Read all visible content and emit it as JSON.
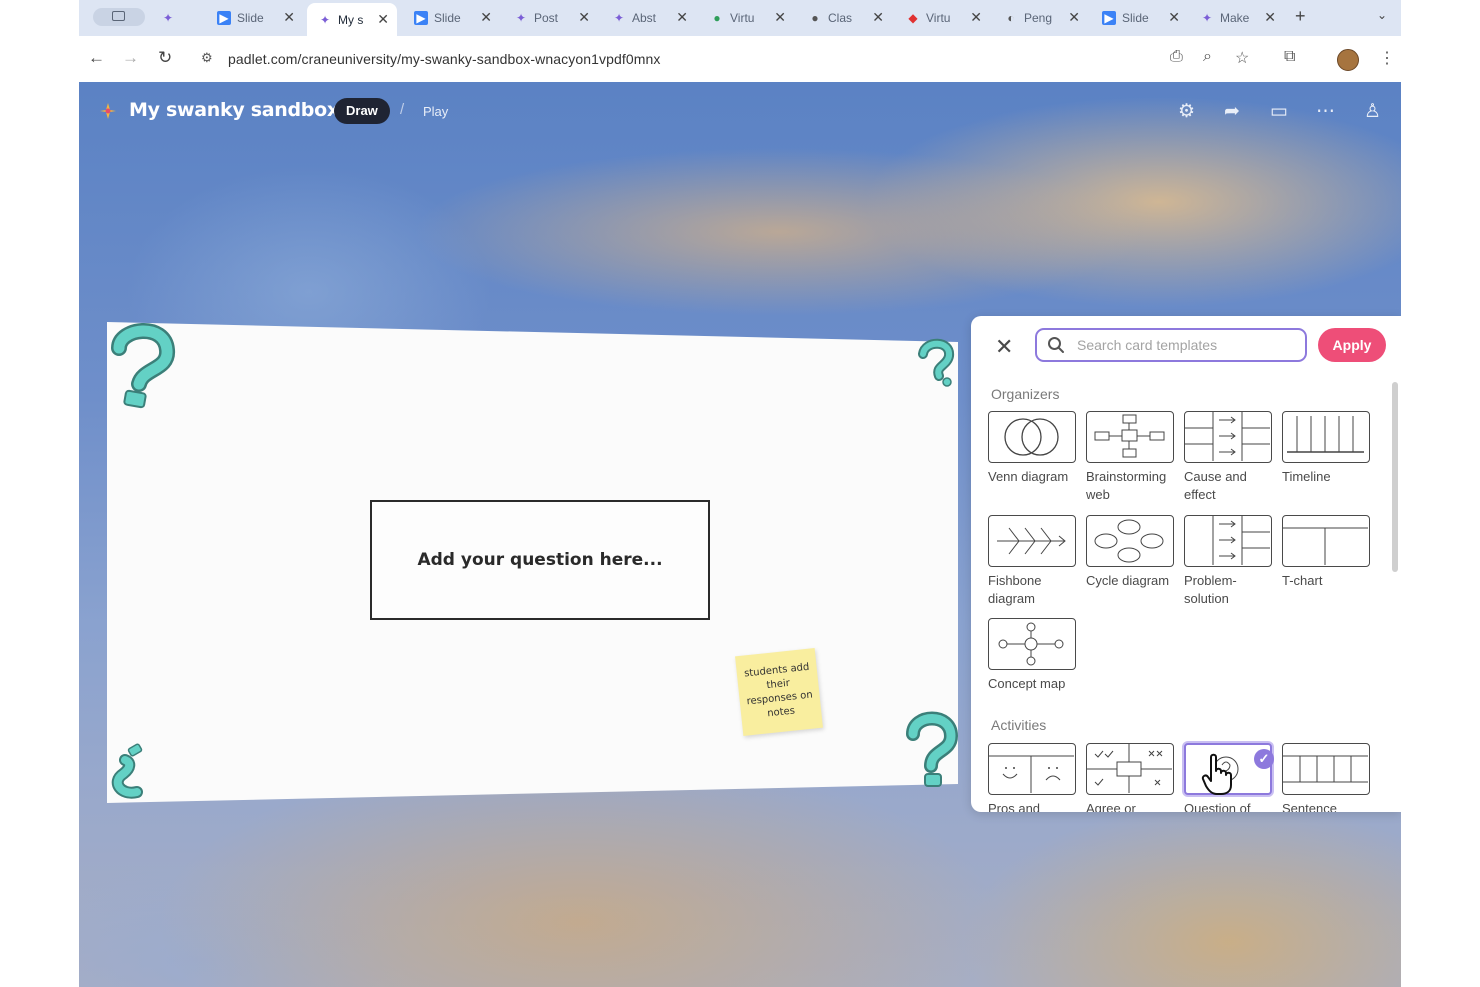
{
  "browser": {
    "tabs": [
      {
        "title": "Slide",
        "icon": "slides-icon",
        "active": false
      },
      {
        "title": "My s",
        "icon": "padlet-icon",
        "active": true
      },
      {
        "title": "Slide",
        "icon": "slides-icon",
        "active": false
      },
      {
        "title": "Post",
        "icon": "padlet-icon",
        "active": false
      },
      {
        "title": "Abst",
        "icon": "padlet-icon",
        "active": false
      },
      {
        "title": "Virtu",
        "icon": "globe-icon",
        "active": false
      },
      {
        "title": "Clas",
        "icon": "microphone-icon",
        "active": false
      },
      {
        "title": "Virtu",
        "icon": "pin-icon",
        "active": false
      },
      {
        "title": "Peng",
        "icon": "penguin-icon",
        "active": false
      },
      {
        "title": "Slide",
        "icon": "slides-icon",
        "active": false
      },
      {
        "title": "Make",
        "icon": "padlet-icon",
        "active": false
      }
    ],
    "url": "padlet.com/craneuniversity/my-swanky-sandbox-wnacyon1vpdf0mnx"
  },
  "board": {
    "title": "My swanky sandbox",
    "modes": {
      "draw": "Draw",
      "separator": "/",
      "play": "Play"
    },
    "question": "Add your question here...",
    "sticky_note": "students add their responses on notes"
  },
  "panel": {
    "search_placeholder": "Search card templates",
    "apply_label": "Apply",
    "sections": {
      "organizers": {
        "title": "Organizers",
        "items": [
          {
            "label": "Venn diagram"
          },
          {
            "label": "Brainstorming web"
          },
          {
            "label": "Cause and effect"
          },
          {
            "label": "Timeline"
          },
          {
            "label": "Fishbone diagram"
          },
          {
            "label": "Cycle diagram"
          },
          {
            "label": "Problem-solution"
          },
          {
            "label": "T-chart"
          },
          {
            "label": "Concept map"
          }
        ]
      },
      "activities": {
        "title": "Activities",
        "items": [
          {
            "label": "Pros and"
          },
          {
            "label": "Agree or"
          },
          {
            "label": "Question of",
            "selected": true
          },
          {
            "label": "Sentence"
          }
        ]
      }
    }
  },
  "colors": {
    "accent": "#8d79dd",
    "apply": "#ee4e78",
    "draw_pill": "#1f2433",
    "question_marks": "#5fcdc1",
    "sticky": "#f9ee9f"
  }
}
